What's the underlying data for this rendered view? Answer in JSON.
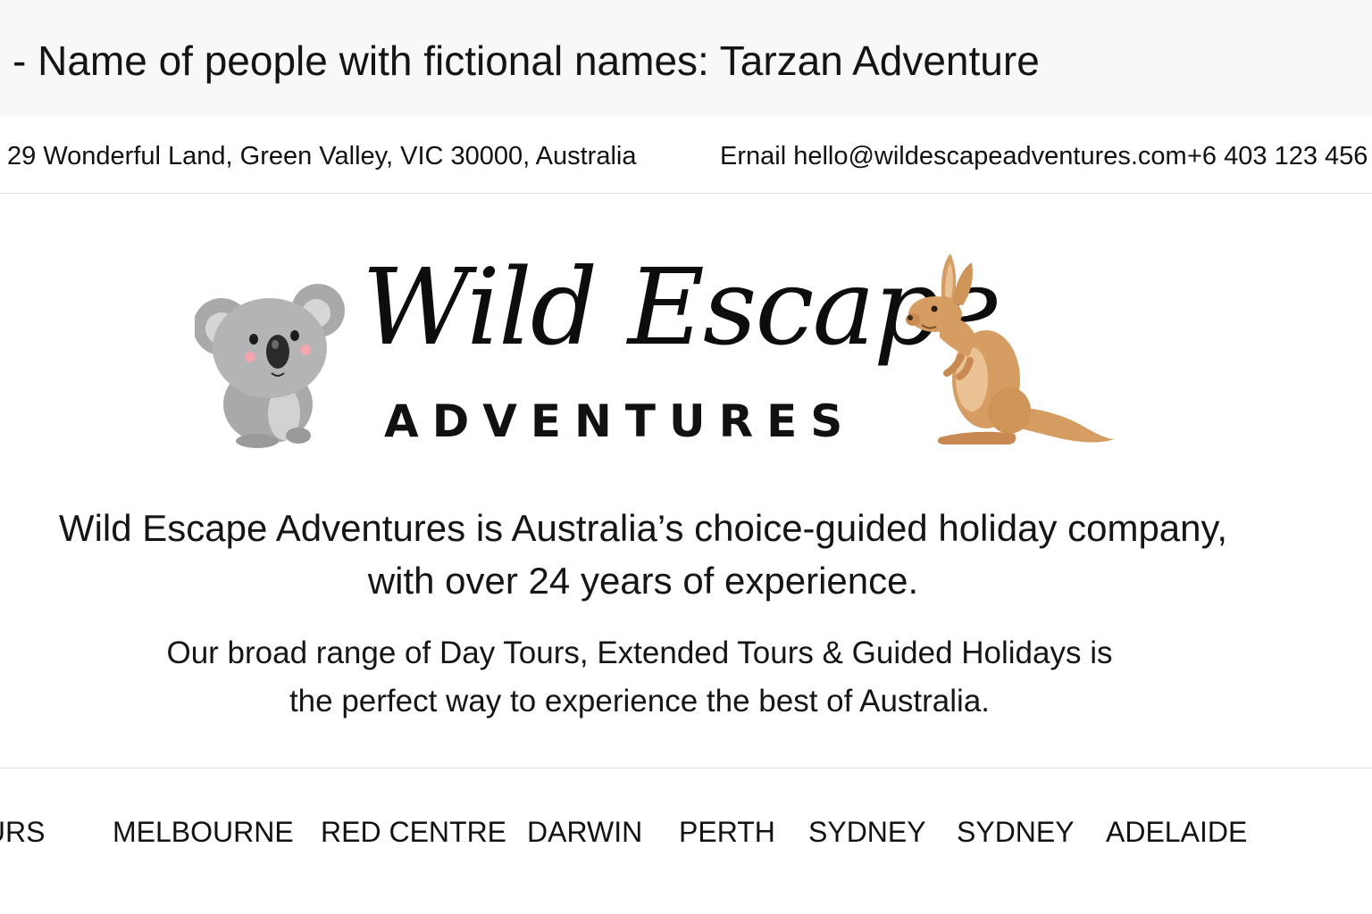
{
  "caption": {
    "text": "- Name of people with fictional names: Tarzan Adventure"
  },
  "contact": {
    "address": "29 Wonderful Land, Green Valley, VIC 30000,  Australia",
    "email": "Ernail hello@wildescapeadventures.com",
    "phone": "+6 403 123 456"
  },
  "logo": {
    "title": "Wild Escape",
    "subtitle": "ADVENTURES",
    "left_icon": "koala-icon",
    "right_icon": "kangaroo-icon"
  },
  "intro": {
    "line1": "Wild Escape Adventures is Australia’s choice-guided holiday company,",
    "line2": "with over 24 years of experience.",
    "line3": "Our broad range of Day Tours, Extended Tours & Guided Holidays is",
    "line4": "the perfect way to experience the best of Australia."
  },
  "nav": {
    "items": [
      "OURS",
      "MELBOURNE",
      "RED CENTRE",
      "DARWIN",
      "PERTH",
      "SYDNEY",
      "SYDNEY",
      "ADELAIDE"
    ]
  },
  "colors": {
    "koala_fur": "#a9a9ab",
    "koala_light": "#d2d2d4",
    "kangaroo_fur": "#d69d63",
    "kangaroo_light": "#ebc293",
    "divider": "#dedede"
  }
}
